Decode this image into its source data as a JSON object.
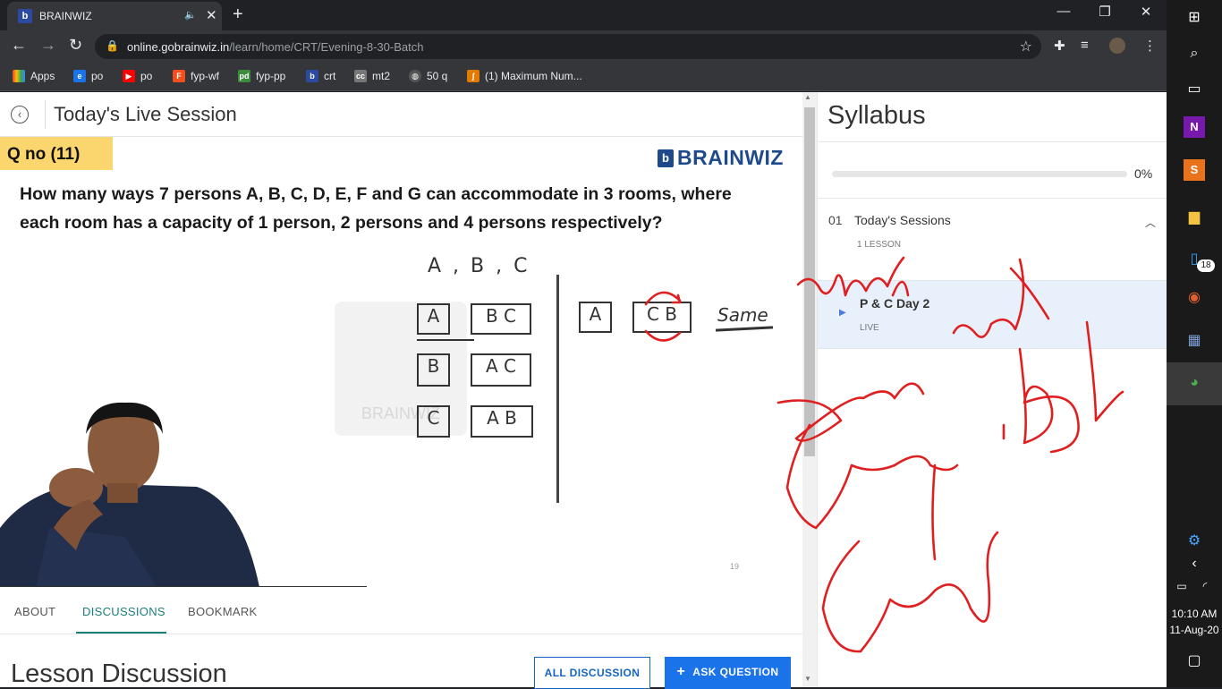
{
  "browser": {
    "tab_title": "BRAINWIZ",
    "new_tab": "+",
    "url_host": "online.gobrainwiz.in",
    "url_path": "/learn/home/CRT/Evening-8-30-Batch",
    "bookmarks": [
      "Apps",
      "po",
      "po",
      "fyp-wf",
      "fyp-pp",
      "crt",
      "mt2",
      "50 q",
      "(1) Maximum Num..."
    ]
  },
  "lesson": {
    "title": "Today's Live Session"
  },
  "slide": {
    "qno": "Q no (11)",
    "logo_text": "BRAINWIZ",
    "watermark": "BRAINWIZ",
    "question_line1": "How many ways 7 persons A, B, C, D, E, F and G can accommodate in 3 rooms, where",
    "question_line2": "each room has a capacity of 1 person, 2 persons and 4 persons respectively?",
    "persons_note": "A , B , C",
    "rows": [
      {
        "single": "A",
        "pair": "B C"
      },
      {
        "single": "B",
        "pair": "A C"
      },
      {
        "single": "C",
        "pair": "A B"
      }
    ],
    "right_single": "A",
    "right_pair": "C B",
    "same_note": "Same",
    "slide_number": "19"
  },
  "tabs": [
    "ABOUT",
    "DISCUSSIONS",
    "BOOKMARK"
  ],
  "discussion": {
    "title": "Lesson Discussion",
    "all_button": "ALL DISCUSSION",
    "ask_button": "ASK QUESTION",
    "ask_icon": "+"
  },
  "syllabus": {
    "title": "Syllabus",
    "progress_pct": "0%",
    "progress_value": 0,
    "section_number": "01",
    "section_title": "Today's Sessions",
    "section_count": "1 LESSON",
    "lesson_name": "P & C Day 2",
    "lesson_status": "LIVE"
  },
  "taskbar": {
    "time": "10:10 AM",
    "date": "11-Aug-20",
    "badge": "18"
  },
  "colors": {
    "accent": "#1b7f79",
    "primary_button": "#1a73e8",
    "ink": "#e02020",
    "highlight": "#fbd56d",
    "brand": "#1e4a8c"
  }
}
